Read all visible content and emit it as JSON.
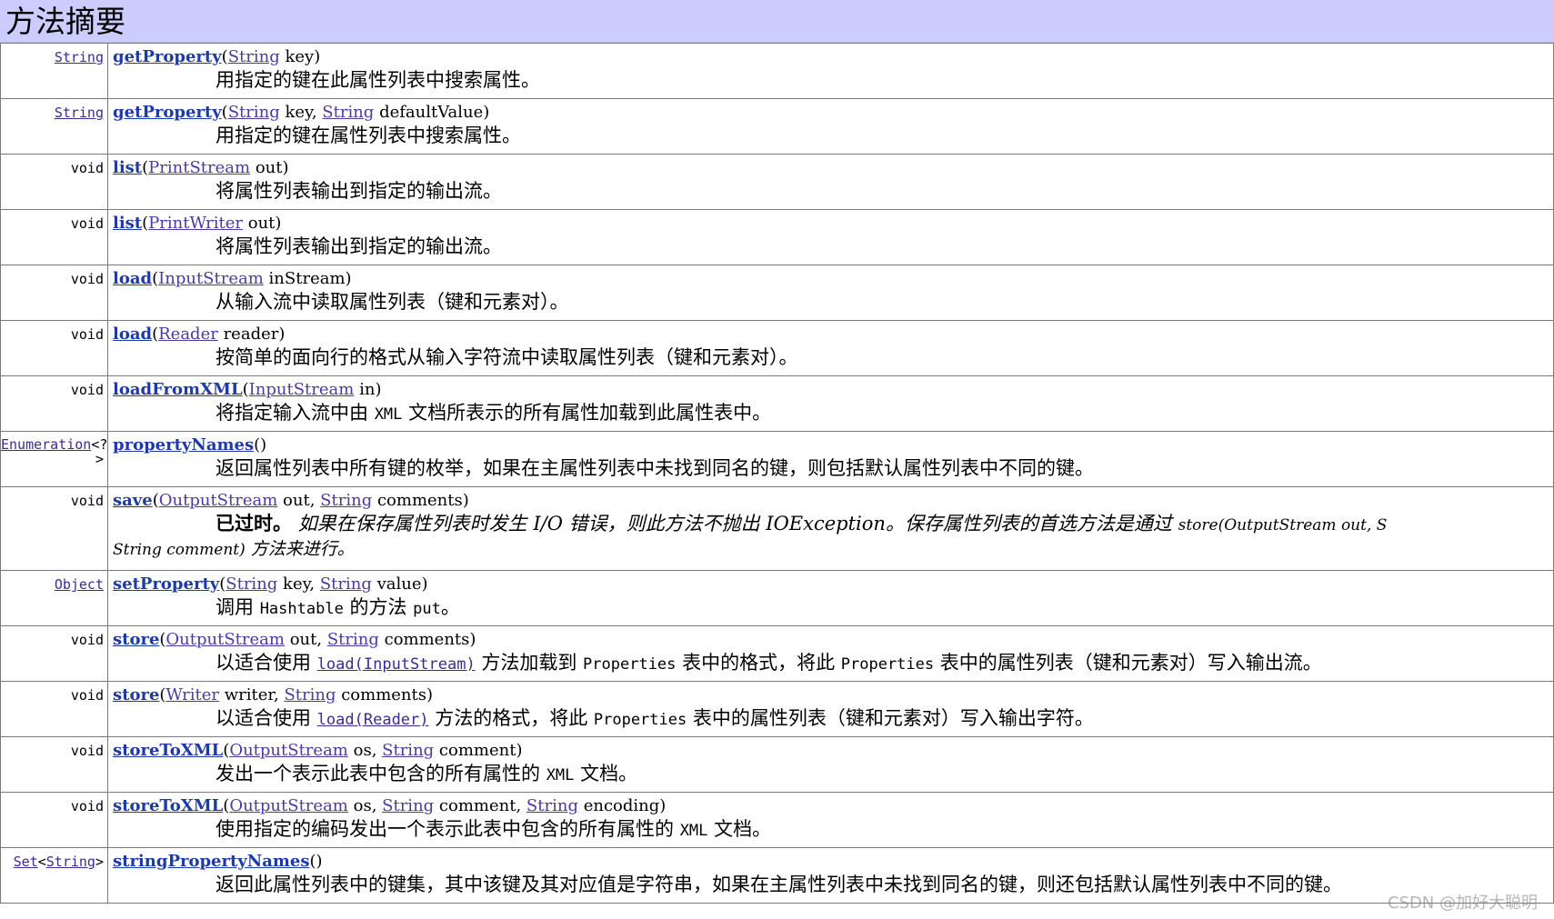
{
  "header": {
    "title": "方法摘要"
  },
  "rows": [
    {
      "ret_link": "String",
      "method": "getProperty",
      "params": [
        {
          "type": "String",
          "name": "key"
        }
      ],
      "desc": "用指定的键在此属性列表中搜索属性。"
    },
    {
      "ret_link": "String",
      "method": "getProperty",
      "params": [
        {
          "type": "String",
          "name": "key"
        },
        {
          "type": "String",
          "name": "defaultValue"
        }
      ],
      "desc": "用指定的键在属性列表中搜索属性。"
    },
    {
      "ret_plain": "void",
      "method": "list",
      "params": [
        {
          "type": "PrintStream",
          "name": "out"
        }
      ],
      "desc": "将属性列表输出到指定的输出流。"
    },
    {
      "ret_plain": "void",
      "method": "list",
      "params": [
        {
          "type": "PrintWriter",
          "name": "out"
        }
      ],
      "desc": "将属性列表输出到指定的输出流。"
    },
    {
      "ret_plain": "void",
      "method": "load",
      "params": [
        {
          "type": "InputStream",
          "name": "inStream"
        }
      ],
      "desc": "从输入流中读取属性列表（键和元素对）。"
    },
    {
      "ret_plain": "void",
      "method": "load",
      "params": [
        {
          "type": "Reader",
          "name": "reader"
        }
      ],
      "desc": "按简单的面向行的格式从输入字符流中读取属性列表（键和元素对）。"
    },
    {
      "ret_plain": "void",
      "method": "loadFromXML",
      "params": [
        {
          "type": "InputStream",
          "name": "in"
        }
      ],
      "desc_parts": [
        "将指定输入流中由 ",
        "XML",
        " 文档所表示的所有属性加载到此属性表中。"
      ]
    },
    {
      "ret_link": "Enumeration",
      "ret_suffix": "<?",
      "ret_suffix2": ">",
      "method": "propertyNames",
      "params": [],
      "desc": "返回属性列表中所有键的枚举，如果在主属性列表中未找到同名的键，则包括默认属性列表中不同的键。"
    },
    {
      "ret_plain": "void",
      "method": "save",
      "params": [
        {
          "type": "OutputStream",
          "name": "out"
        },
        {
          "type": "String",
          "name": "comments"
        }
      ],
      "dep_label": "已过时。",
      "dep_text": "如果在保存属性列表时发生 I/O 错误，则此方法不抛出 IOException。保存属性列表的首选方法是通过",
      "dep_code": "store(OutputStream out, S",
      "dep_line2_code": "String comment)",
      "dep_line2_text": " 方法来进行。"
    },
    {
      "ret_link": "Object",
      "method": "setProperty",
      "params": [
        {
          "type": "String",
          "name": "key"
        },
        {
          "type": "String",
          "name": "value"
        }
      ],
      "desc_parts": [
        "调用 ",
        "Hashtable",
        " 的方法 ",
        "put",
        "。"
      ]
    },
    {
      "ret_plain": "void",
      "method": "store",
      "params": [
        {
          "type": "OutputStream",
          "name": "out"
        },
        {
          "type": "String",
          "name": "comments"
        }
      ],
      "desc_parts": [
        "以适合使用 ",
        "load(InputStream)",
        " 方法加载到 ",
        "Properties",
        " 表中的格式，将此 ",
        "Properties",
        " 表中的属性列表（键和元素对）写入输出流。"
      ]
    },
    {
      "ret_plain": "void",
      "method": "store",
      "params": [
        {
          "type": "Writer",
          "name": "writer"
        },
        {
          "type": "String",
          "name": "comments"
        }
      ],
      "desc_parts": [
        "以适合使用 ",
        "load(Reader)",
        " 方法的格式，将此 ",
        "Properties",
        " 表中的属性列表（键和元素对）写入输出字符。"
      ]
    },
    {
      "ret_plain": "void",
      "method": "storeToXML",
      "params": [
        {
          "type": "OutputStream",
          "name": "os"
        },
        {
          "type": "String",
          "name": "comment"
        }
      ],
      "desc_parts": [
        "发出一个表示此表中包含的所有属性的 ",
        "XML",
        " 文档。"
      ]
    },
    {
      "ret_plain": "void",
      "method": "storeToXML",
      "params": [
        {
          "type": "OutputStream",
          "name": "os"
        },
        {
          "type": "String",
          "name": "comment"
        },
        {
          "type": "String",
          "name": "encoding"
        }
      ],
      "desc_parts": [
        "使用指定的编码发出一个表示此表中包含的所有属性的 ",
        "XML",
        " 文档。"
      ]
    },
    {
      "ret_link": "Set",
      "ret_mid": "<",
      "ret_link2": "String",
      "ret_suffix": ">",
      "method": "stringPropertyNames",
      "params": [],
      "desc": "返回此属性列表中的键集，其中该键及其对应值是字符串，如果在主属性列表中未找到同名的键，则还包括默认属性列表中不同的键。"
    }
  ],
  "watermark": "CSDN @加好大聪明"
}
